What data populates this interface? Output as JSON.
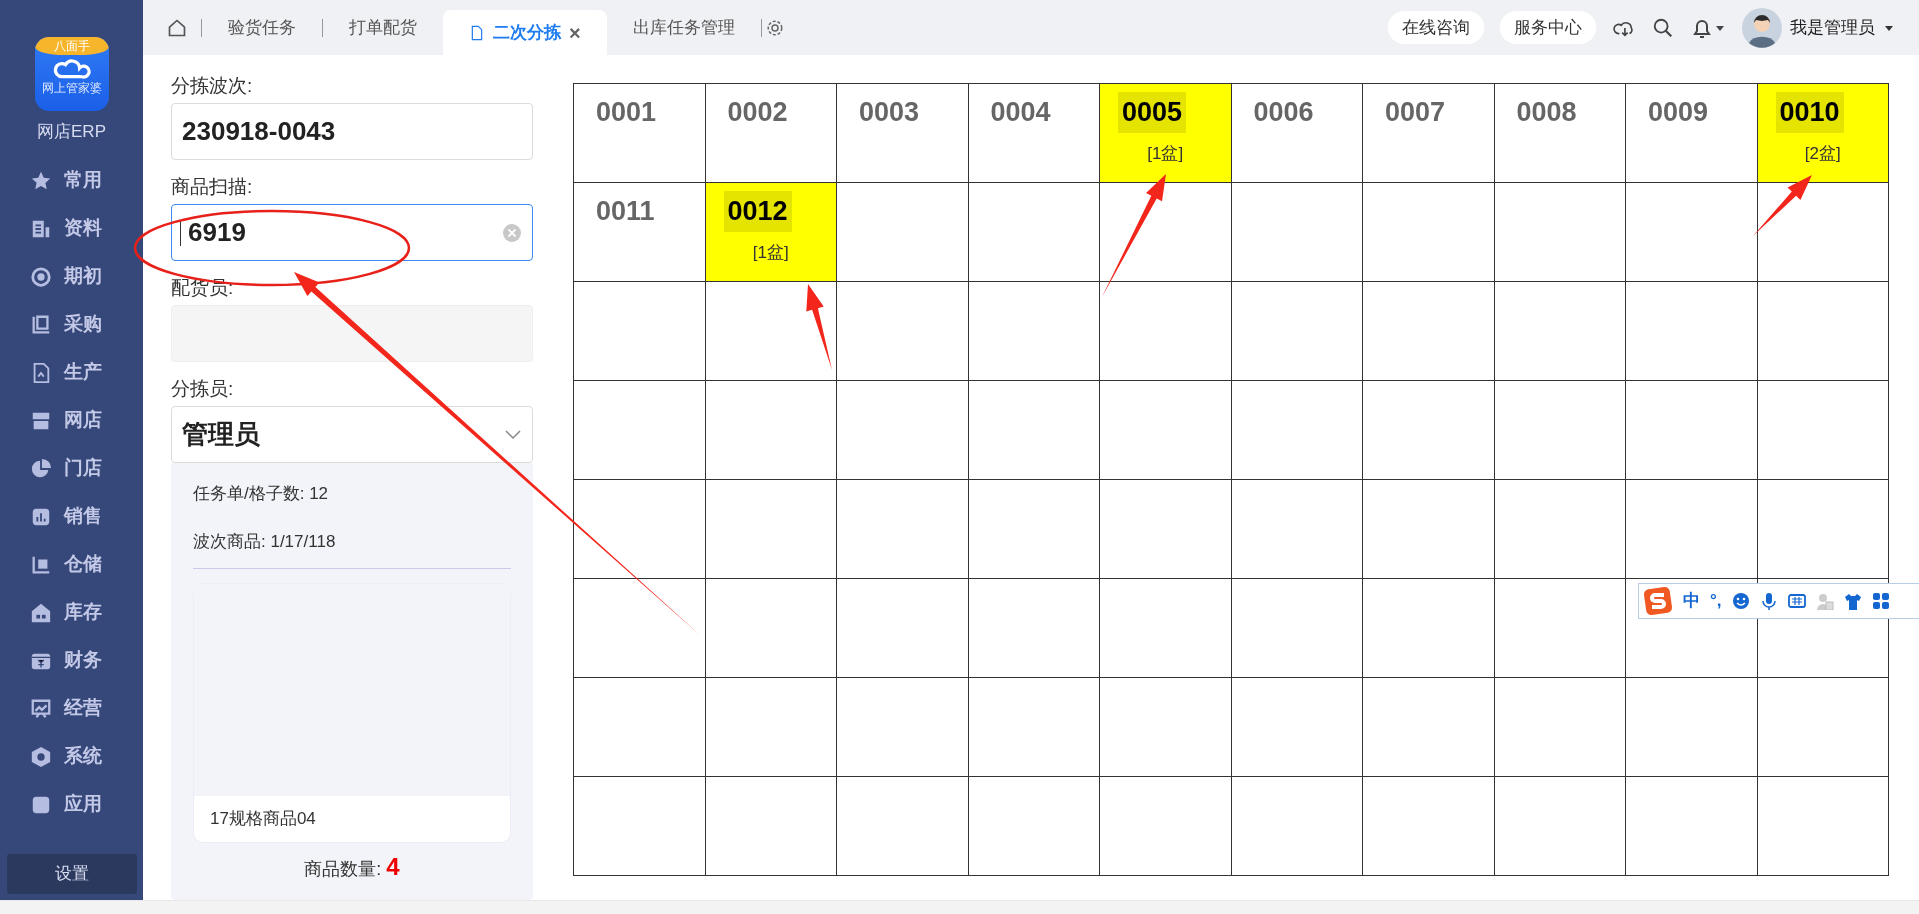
{
  "sidebar": {
    "logo": {
      "badge": "八面手",
      "caption": "网上管家婆"
    },
    "title": "网店ERP",
    "items": [
      {
        "label": "常用"
      },
      {
        "label": "资料"
      },
      {
        "label": "期初"
      },
      {
        "label": "采购"
      },
      {
        "label": "生产"
      },
      {
        "label": "网店"
      },
      {
        "label": "门店"
      },
      {
        "label": "销售"
      },
      {
        "label": "仓储"
      },
      {
        "label": "库存"
      },
      {
        "label": "财务"
      },
      {
        "label": "经营"
      },
      {
        "label": "系统"
      },
      {
        "label": "应用"
      }
    ],
    "settings_button": "设置"
  },
  "tabs": [
    {
      "label": "验货任务",
      "selected": false,
      "closable": false
    },
    {
      "label": "打单配货",
      "selected": false,
      "closable": false
    },
    {
      "label": "二次分拣",
      "selected": true,
      "closable": true,
      "close": "×"
    },
    {
      "label": "出库任务管理",
      "selected": false,
      "closable": false
    }
  ],
  "header": {
    "buttons": [
      "在线咨询",
      "服务中心"
    ],
    "user": "我是管理员"
  },
  "form": {
    "fields": [
      {
        "label": "分拣波次:",
        "value": "230918-0043",
        "kind": "input",
        "focused": false,
        "disabled": false
      },
      {
        "label": "商品扫描:",
        "value": "6919",
        "kind": "input",
        "focused": true,
        "disabled": false,
        "clearable": true
      },
      {
        "label": "配货员:",
        "kind": "input",
        "focused": false,
        "disabled": true
      },
      {
        "label": "分拣员:",
        "value": "管理员",
        "kind": "select",
        "focused": false,
        "disabled": false
      }
    ],
    "stats": [
      "任务单/格子数: 12",
      "波次商品: 1/17/118"
    ],
    "product": {
      "name": "17规格商品04"
    },
    "quantity": {
      "label": "商品数量:",
      "value": "4"
    }
  },
  "grid": {
    "cells": [
      {
        "label": "0001",
        "filled": false
      },
      {
        "label": "0002",
        "filled": false
      },
      {
        "label": "0003",
        "filled": false
      },
      {
        "label": "0004",
        "filled": false
      },
      {
        "label": "0005",
        "filled": true,
        "note": "[1盆]"
      },
      {
        "label": "0006",
        "filled": false
      },
      {
        "label": "0007",
        "filled": false
      },
      {
        "label": "0008",
        "filled": false
      },
      {
        "label": "0009",
        "filled": false
      },
      {
        "label": "0010",
        "filled": true,
        "note": "[2盆]"
      },
      {
        "label": "0011",
        "filled": false
      },
      {
        "label": "0012",
        "filled": true,
        "note": "[1盆]"
      }
    ]
  },
  "ime": {
    "mode": "中",
    "punctuation": "°,"
  }
}
